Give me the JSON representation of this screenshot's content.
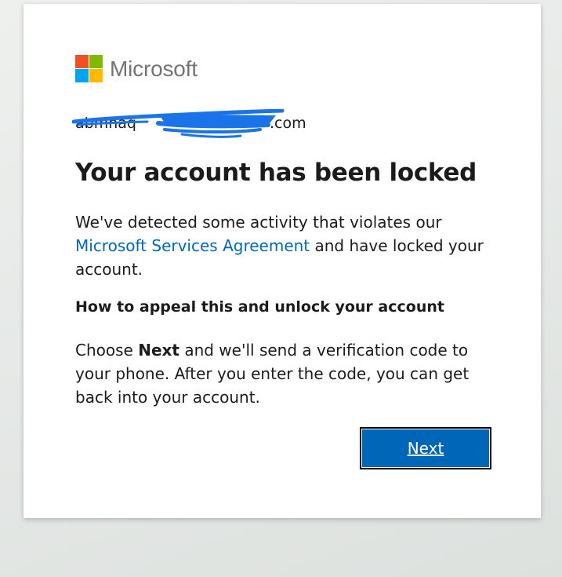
{
  "brand": {
    "name": "Microsoft",
    "colors": {
      "red": "#f25022",
      "green": "#7fba00",
      "blue": "#00a4ef",
      "yellow": "#ffb900"
    }
  },
  "identity": {
    "email_prefix": "abmhaq",
    "email_suffix": ".com"
  },
  "title": "Your account has been locked",
  "notice": {
    "before_link": "We've detected some activity that violates our ",
    "link_text": "Microsoft Services Agreement",
    "after_link": " and have locked your account."
  },
  "appeal": {
    "heading": "How to appeal this and unlock your account",
    "text_before": "Choose ",
    "text_bold": "Next",
    "text_after": " and we'll send a verification code to your phone. After you enter the code, you can get back into your account."
  },
  "actions": {
    "next_label": "Next"
  },
  "accent_color": "#0067b8"
}
